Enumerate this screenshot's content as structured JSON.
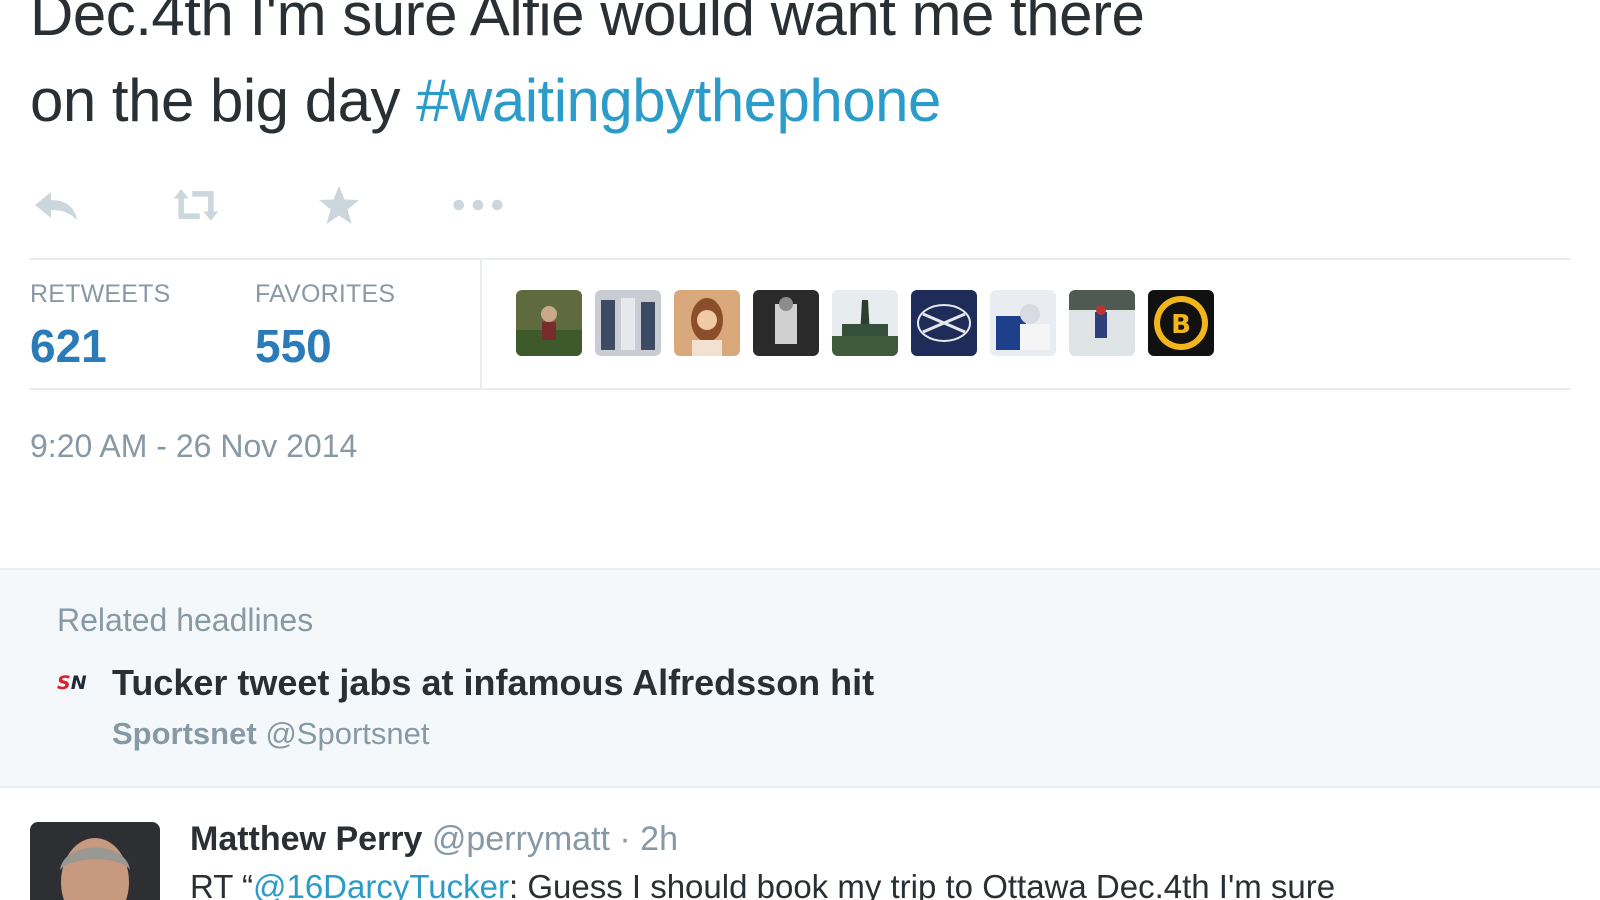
{
  "tweet": {
    "line1": "Dec.4th I'm sure Alfie would want me there",
    "line2": "on the big day ",
    "hashtag": "#waitingbythephone"
  },
  "actions": {
    "icons": [
      "reply-icon",
      "retweet-icon",
      "favorite-star-icon",
      "more-dots-icon"
    ]
  },
  "stats": {
    "retweets_label": "RETWEETS",
    "retweets_count": "621",
    "favorites_label": "FAVORITES",
    "favorites_count": "550"
  },
  "timestamp": "9:20 AM - 26 Nov 2014",
  "related": {
    "title": "Related headlines",
    "logo_text_a": "S",
    "logo_text_b": "N",
    "headline": "Tucker tweet jabs at infamous Alfredsson hit",
    "source_name": "Sportsnet",
    "source_handle": "@Sportsnet"
  },
  "reply": {
    "name": "Matthew Perry",
    "meta": "@perrymatt · 2h",
    "body_prefix": "RT “",
    "mention": "@16DarcyTucker",
    "body_rest": ": Guess I should book my trip to Ottawa Dec.4th I'm sure"
  },
  "colors": {
    "link_blue": "#2b9bc9",
    "count_blue": "#2b7bb9",
    "muted_gray": "#8899a6",
    "text_dark": "#292f33",
    "related_bg": "#f5f8fa"
  }
}
